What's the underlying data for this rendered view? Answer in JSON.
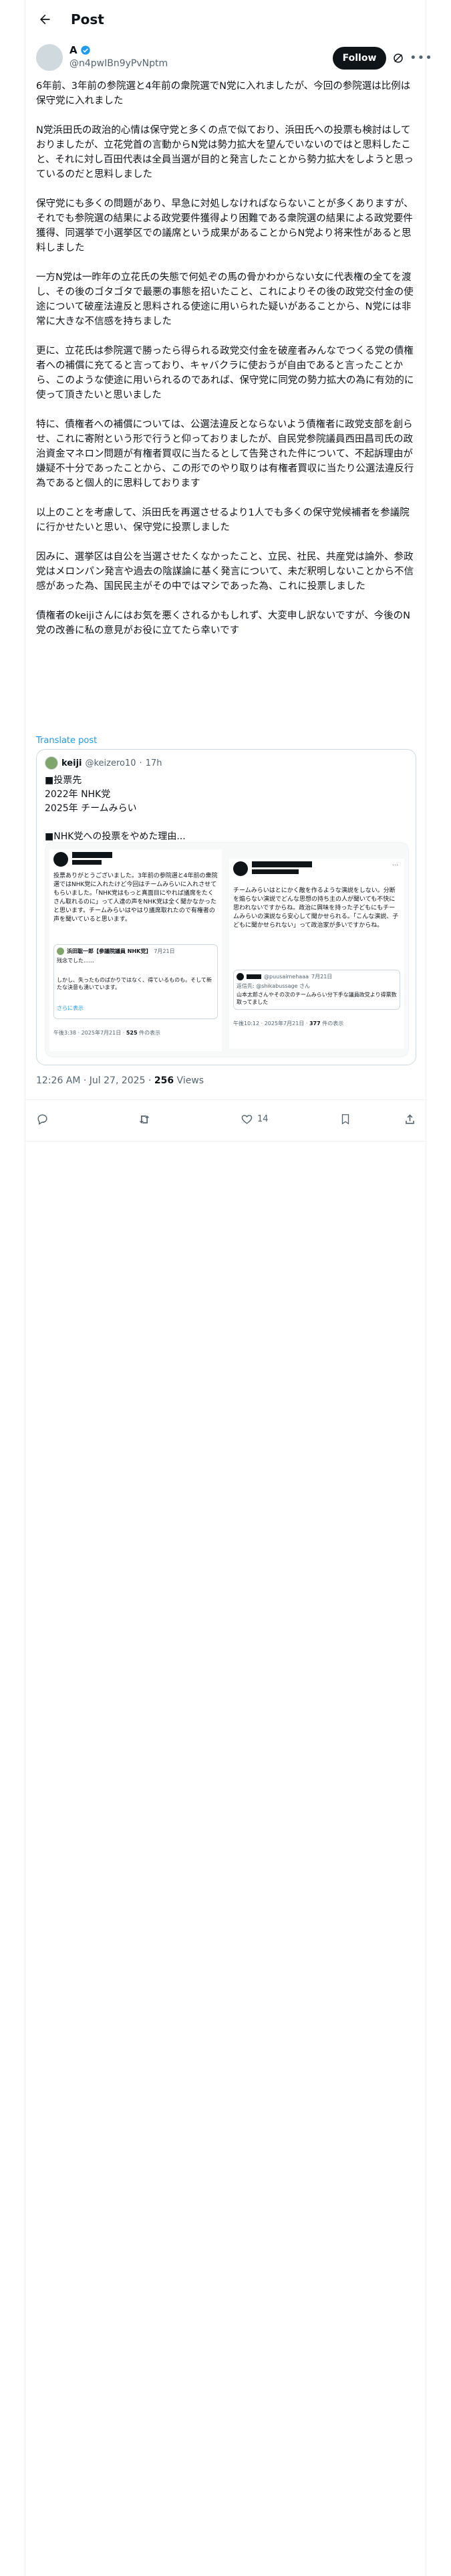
{
  "header": {
    "title": "Post"
  },
  "author": {
    "display_name": "A",
    "handle": "@n4pwIBn9yPvNptm",
    "follow_label": "Follow"
  },
  "post": {
    "paragraphs": [
      "6年前、3年前の参院選と4年前の衆院選でN党に入れましたが、今回の参院選は比例は保守党に入れました",
      "N党浜田氏の政治的心情は保守党と多くの点で似ており、浜田氏への投票も検討はしておりましたが、立花党首の言動からN党は勢力拡大を望んでいないのではと思料したこと、それに対し百田代表は全員当選が目的と発言したことから勢力拡大をしようと思っているのだと思料しました",
      "保守党にも多くの問題があり、早急に対処しなければならないことが多くありますが、それでも参院選の結果による政党要件獲得より困難である衆院選の結果による政党要件獲得、同選挙で小選挙区での議席という成果があることからN党より将来性があると思料しました",
      "一方N党は一昨年の立花氏の失態で何処ぞの馬の骨かわからない女に代表権の全てを渡し、その後のゴタゴタで最悪の事態を招いたこと、これによりその後の政党交付金の使途について破産法違反と思料される使途に用いられた疑いがあることから、N党には非常に大きな不信感を持ちました",
      "更に、立花氏は参院選で勝ったら得られる政党交付金を破産者みんなでつくる党の債権者への補償に充てると言っており、キャバクラに使おうが自由であると言ったことから、このような使途に用いられるのであれば、保守党に同党の勢力拡大の為に有効的に使って頂きたいと思いました",
      "特に、債権者への補償については、公選法違反とならないよう債権者に政党支部を創らせ、これに寄附という形で行うと仰っておりましたが、自民党参院議員西田昌司氏の政治資金マネロン問題が有権者買収に当たるとして告発された件について、不起訴理由が嫌疑不十分であったことから、この形でのやり取りは有権者買収に当たり公選法違反行為であると個人的に思料しております",
      "以上のことを考慮して、浜田氏を再選させるより1人でも多くの保守党候補者を参議院に行かせたいと思い、保守党に投票しました",
      "因みに、選挙区は自公を当選させたくなかったこと、立民、社民、共産党は論外、参政党はメロンパン発言や過去の陰謀論に基く発言について、未だ釈明しないことから不信感があった為、国民民主がその中ではマシであった為、これに投票しました",
      "債権者のkeijiさんにはお気を悪くされるかもしれず、大変申し訳ないですが、今後のN党の改善に私の意見がお役に立てたら幸いです"
    ],
    "translate_label": "Translate post",
    "timestamp": "12:26 AM · Jul 27, 2025",
    "separator": "·",
    "views_count": "256",
    "views_label": "Views"
  },
  "quote": {
    "name": "keiji",
    "handle": "@keizero10",
    "time": "17h",
    "lines": [
      "■投票先",
      "2022年 NHK党",
      "2025年 チームみらい",
      "",
      "■NHK党への投票をやめた理由..."
    ],
    "left_shot": {
      "text": "投票ありがとうございました。3年前の参院選と4年前の衆院選ではNHK党に入れたけど今回はチームみらいに入れさせてもらいました。「NHK党はもっと真面目にやれば議席をたくさん取れるのに」って人達の声をNHK党は全く聞かなかったと思います。チームみらいはやはり議席取れたので有権者の声を聞いていると思います。",
      "mini_name": "浜田聡一郎【参議院議員 NHK党】",
      "mini_time": "7月21日",
      "mini_text_1": "残念でした……",
      "mini_text_2": "しかし、失ったものばかりではなく、得ているものも。そして新たな決意も湧いています。",
      "mini_more": "さらに表示",
      "stamp": "午後3:38 · 2025年7月21日 ·",
      "views": "525",
      "views_label": "件の表示"
    },
    "right_shot": {
      "text": "チームみらいはとにかく敵を作るような演説をしない。分断を煽らない演説でどんな思想の持ち主の人が聞いても不快に思われないですからね。政治に興味を持った子どもにもチームみらいの演説なら安心して聞かせられる。「こんな演説、子どもに聞かせられない」って政治家が多いですからね。",
      "mini_handle": "@puusaimehaaa",
      "mini_time": "7月21日",
      "mini_reply": "返信先: @shikabussage さん",
      "mini_text": "山本太郎さんやその次のチームみらい分下手な議員政党より得票数取ってました",
      "stamp": "午後10:12 · 2025年7月21日 ·",
      "views": "377",
      "views_label": "件の表示"
    }
  },
  "actions": {
    "reply_count": "",
    "repost_count": "",
    "like_count": "14",
    "bookmark_count": ""
  },
  "icons": {
    "back": "back-arrow-icon",
    "verified": "verified-badge-icon",
    "grok": "grok-icon",
    "more": "more-dots-icon",
    "reply": "reply-icon",
    "repost": "repost-icon",
    "like": "heart-icon",
    "bookmark": "bookmark-icon",
    "share": "share-icon"
  },
  "colors": {
    "accent": "#1d9bf0",
    "text": "#0f1419",
    "muted": "#536471",
    "border": "#eff3f4"
  }
}
